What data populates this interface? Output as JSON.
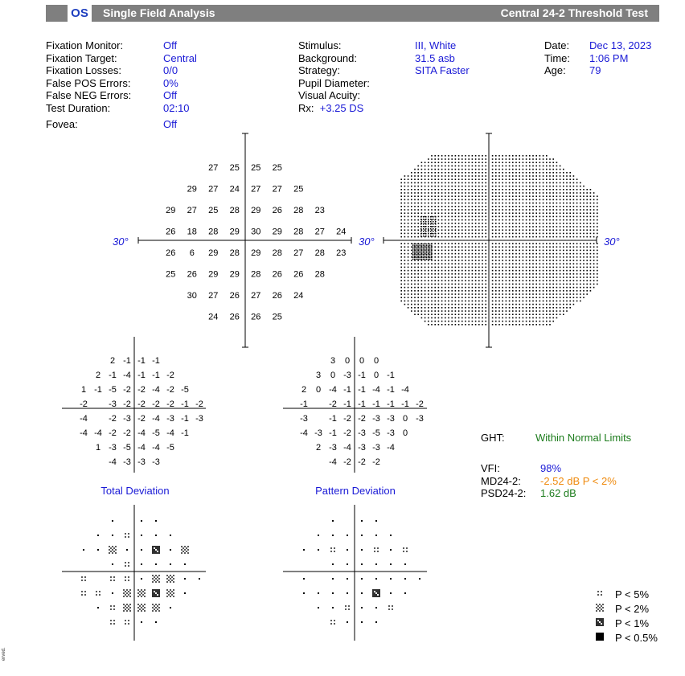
{
  "header": {
    "eye": "OS",
    "title": "Single Field Analysis",
    "test": "Central 24-2 Threshold Test"
  },
  "info_left": [
    {
      "label": "Fixation Monitor:",
      "value": "Off"
    },
    {
      "label": "Fixation Target:",
      "value": "Central"
    },
    {
      "label": "Fixation Losses:",
      "value": "0/0"
    },
    {
      "label": "False POS Errors:",
      "value": "0%"
    },
    {
      "label": "False NEG Errors:",
      "value": "Off"
    },
    {
      "label": "Test Duration:",
      "value": "02:10"
    },
    {
      "label": "Fovea:",
      "value": "Off"
    }
  ],
  "info_mid": [
    {
      "label": "Stimulus:",
      "value": "III, White"
    },
    {
      "label": "Background:",
      "value": "31.5 asb"
    },
    {
      "label": "Strategy:",
      "value": "SITA Faster"
    },
    {
      "label": "Pupil Diameter:",
      "value": ""
    },
    {
      "label": "Visual Acuity:",
      "value": ""
    }
  ],
  "rx": {
    "label": "Rx:",
    "value": "+3.25 DS"
  },
  "info_right": [
    {
      "label": "Date:",
      "value": "Dec 13, 2023"
    },
    {
      "label": "Time:",
      "value": "1:06 PM"
    },
    {
      "label": "Age:",
      "value": "79"
    }
  ],
  "axis_label": "30°",
  "threshold_rows": [
    [
      "",
      "",
      "27",
      "25",
      "25",
      "25",
      "",
      ""
    ],
    [
      "",
      "29",
      "27",
      "24",
      "27",
      "27",
      "25",
      ""
    ],
    [
      "29",
      "27",
      "25",
      "28",
      "29",
      "26",
      "28",
      "23"
    ],
    [
      "26",
      "18",
      "28",
      "29",
      "30",
      "29",
      "28",
      "27",
      "24"
    ],
    [
      "26",
      "6",
      "29",
      "28",
      "29",
      "28",
      "27",
      "28",
      "23"
    ],
    [
      "25",
      "26",
      "29",
      "29",
      "28",
      "26",
      "26",
      "28"
    ],
    [
      "",
      "30",
      "27",
      "26",
      "27",
      "26",
      "24",
      ""
    ],
    [
      "",
      "",
      "24",
      "26",
      "26",
      "25",
      "",
      ""
    ]
  ],
  "total_deviation_rows": [
    [
      "",
      "",
      "2",
      "-1",
      "-1",
      "-1",
      "",
      ""
    ],
    [
      "",
      "2",
      "-1",
      "-4",
      "-1",
      "-1",
      "-2",
      ""
    ],
    [
      "1",
      "-1",
      "-5",
      "-2",
      "-2",
      "-4",
      "-2",
      "-5"
    ],
    [
      "-2",
      "",
      "-3",
      "-2",
      "-2",
      "-2",
      "-2",
      "-1",
      "-2"
    ],
    [
      "-4",
      "",
      "-2",
      "-3",
      "-2",
      "-4",
      "-3",
      "-1",
      "-3"
    ],
    [
      "-4",
      "-4",
      "-2",
      "-2",
      "-4",
      "-5",
      "-4",
      "-1"
    ],
    [
      "",
      "1",
      "-3",
      "-5",
      "-4",
      "-4",
      "-5",
      ""
    ],
    [
      "",
      "",
      "-4",
      "-3",
      "-3",
      "-3",
      "",
      ""
    ]
  ],
  "pattern_deviation_rows": [
    [
      "",
      "",
      "3",
      "0",
      "0",
      "0",
      "",
      ""
    ],
    [
      "",
      "3",
      "0",
      "-3",
      "-1",
      "0",
      "-1",
      ""
    ],
    [
      "2",
      "0",
      "-4",
      "-1",
      "-1",
      "-4",
      "-1",
      "-4"
    ],
    [
      "-1",
      "",
      "-2",
      "-1",
      "-1",
      "-1",
      "-1",
      "-1",
      "-2"
    ],
    [
      "-3",
      "",
      "-1",
      "-2",
      "-2",
      "-3",
      "-3",
      "0",
      "-3"
    ],
    [
      "-4",
      "-3",
      "-1",
      "-2",
      "-3",
      "-5",
      "-3",
      "0"
    ],
    [
      "",
      "2",
      "-3",
      "-4",
      "-3",
      "-3",
      "-4",
      ""
    ],
    [
      "",
      "",
      "-4",
      "-2",
      "-2",
      "-2",
      "",
      ""
    ]
  ],
  "total_deviation_label": "Total Deviation",
  "pattern_deviation_label": "Pattern Deviation",
  "total_prob_rows": [
    [
      0,
      0,
      1,
      0,
      1,
      1,
      0,
      0
    ],
    [
      0,
      1,
      1,
      2,
      1,
      1,
      1,
      0
    ],
    [
      1,
      1,
      3,
      1,
      1,
      4,
      1,
      3
    ],
    [
      0,
      0,
      1,
      2,
      1,
      1,
      1,
      1,
      0
    ],
    [
      2,
      0,
      2,
      2,
      1,
      3,
      3,
      1,
      1
    ],
    [
      2,
      2,
      1,
      3,
      3,
      4,
      3,
      1
    ],
    [
      0,
      1,
      2,
      3,
      3,
      3,
      1,
      0
    ],
    [
      0,
      0,
      2,
      2,
      1,
      1,
      0,
      0
    ]
  ],
  "pattern_prob_rows": [
    [
      0,
      0,
      1,
      0,
      1,
      1,
      0,
      0
    ],
    [
      0,
      1,
      1,
      1,
      1,
      1,
      1,
      0
    ],
    [
      1,
      1,
      2,
      1,
      1,
      2,
      1,
      2
    ],
    [
      0,
      0,
      1,
      1,
      1,
      1,
      1,
      1,
      0
    ],
    [
      1,
      0,
      1,
      1,
      1,
      1,
      1,
      1,
      1
    ],
    [
      1,
      1,
      1,
      1,
      1,
      4,
      1,
      1
    ],
    [
      0,
      1,
      1,
      2,
      1,
      1,
      2,
      0
    ],
    [
      0,
      0,
      2,
      1,
      1,
      1,
      0,
      0
    ]
  ],
  "ght": {
    "label": "GHT:",
    "value": "Within Normal Limits",
    "color": "#1c7c1c"
  },
  "indices": [
    {
      "label": "VFI:",
      "value": "98%",
      "color": "#1a1ad6"
    },
    {
      "label": "MD24-2:",
      "value": "-2.52 dB P < 2%",
      "color": "#ef8a0d"
    },
    {
      "label": "PSD24-2:",
      "value": "1.62 dB",
      "color": "#1c7c1c"
    }
  ],
  "legend": [
    {
      "symbol": "p5",
      "label": "P < 5%"
    },
    {
      "symbol": "p2",
      "label": "P < 2%"
    },
    {
      "symbol": "p1",
      "label": "P < 1%"
    },
    {
      "symbol": "p05",
      "label": "P < 0.5%"
    }
  ],
  "footer_text": "erved."
}
